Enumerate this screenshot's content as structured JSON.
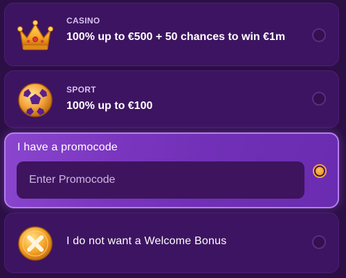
{
  "options": {
    "casino": {
      "category": "CASINO",
      "offer": "100% up to €500 + 50 chances to win €1m",
      "icon": "crown-icon",
      "selected": false
    },
    "sport": {
      "category": "SPORT",
      "offer": "100% up to €100",
      "icon": "soccer-ball-icon",
      "selected": false
    },
    "promocode": {
      "label": "I have a promocode",
      "input_value": "",
      "input_placeholder": "Enter Promocode",
      "selected": true
    },
    "no_bonus": {
      "label": "I do not want a Welcome Bonus",
      "icon": "cross-coin-icon",
      "selected": false
    }
  },
  "colors": {
    "background": "#2c0f45",
    "card": "#3d1461",
    "selected_card": "#7a35be",
    "accent_orange": "#f6a534"
  }
}
